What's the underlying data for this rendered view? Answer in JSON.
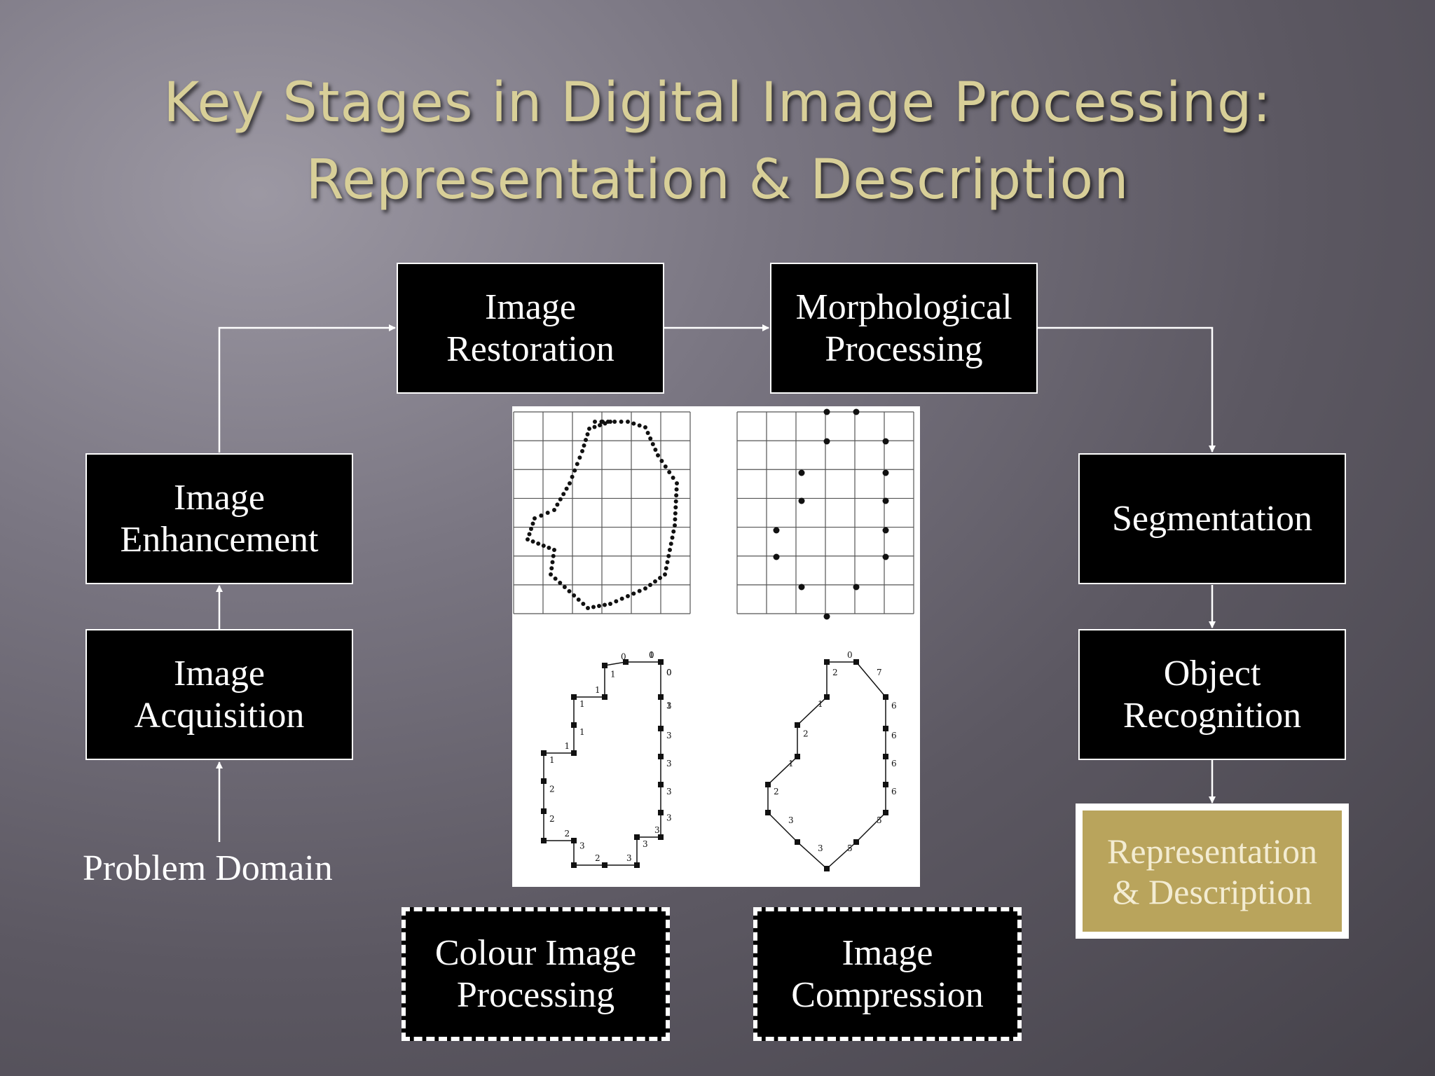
{
  "title": {
    "line1": "Key Stages in Digital Image Processing:",
    "line2": "Representation & Description"
  },
  "stages": {
    "image_acquisition": "Image\nAcquisition",
    "image_enhancement": "Image\nEnhancement",
    "image_restoration": "Image\nRestoration",
    "morphological_processing": "Morphological\nProcessing",
    "segmentation": "Segmentation",
    "object_recognition": "Object\nRecognition",
    "representation_description": "Representation\n& Description",
    "colour_image_processing": "Colour Image\nProcessing",
    "image_compression": "Image\nCompression"
  },
  "problem_domain": "Problem Domain",
  "figure": {
    "chain_code_labels_left": [
      "0",
      "0",
      "3",
      "3",
      "3",
      "3",
      "3",
      "3",
      "3",
      "3",
      "2",
      "3",
      "2",
      "2",
      "2",
      "1",
      "1",
      "1",
      "1",
      "1",
      "1",
      "0",
      "1",
      "0",
      "1"
    ],
    "chain_code_labels_right": [
      "0",
      "7",
      "6",
      "6",
      "6",
      "6",
      "5",
      "5",
      "3",
      "3",
      "2",
      "1",
      "2",
      "1",
      "2"
    ]
  },
  "colors": {
    "title": "#d8cf98",
    "box_fill": "#000000",
    "box_border": "#ffffff",
    "highlight_fill": "#b9a45c",
    "highlight_text": "#f3ecd2"
  }
}
